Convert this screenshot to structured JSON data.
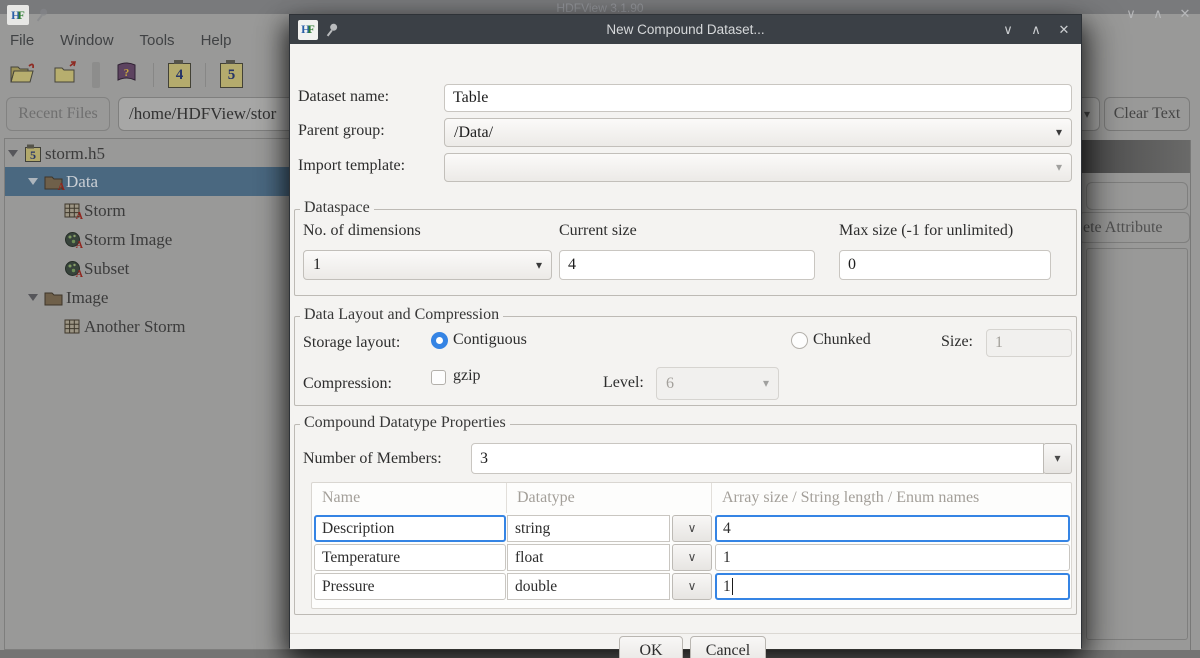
{
  "colors": {
    "accent": "#3584e4",
    "dialog_title_bar": "#3b4046",
    "tree_selection": "#4a6880",
    "dim_background": "#999998"
  },
  "icons": {
    "dropdown": "▾",
    "chevron_down": "∨",
    "minimize": "∨",
    "maximize": "∧",
    "close": "✕",
    "help_glyph": "?",
    "hdf4_glyph": "4",
    "hdf5_glyph": "5",
    "logo_h": "H",
    "logo_f": "F"
  },
  "main_window": {
    "title": "HDFView 3.1.90",
    "menu": {
      "file": "File",
      "window": "Window",
      "tools": "Tools",
      "help": "Help"
    },
    "recent_files_label": "Recent Files",
    "path_value": "/home/HDFView/stor",
    "clear_text_label": "Clear Text",
    "delete_attribute_partial_label": "ete Attribute",
    "tree": {
      "items": [
        {
          "label": "storm.h5"
        },
        {
          "label": "Data"
        },
        {
          "label": "Storm"
        },
        {
          "label": "Storm Image"
        },
        {
          "label": "Subset"
        },
        {
          "label": "Image"
        },
        {
          "label": "Another Storm"
        }
      ]
    },
    "attr_badge": "A"
  },
  "dialog": {
    "title": "New Compound Dataset...",
    "fields": {
      "dataset_name_label": "Dataset name:",
      "dataset_name_value": "Table",
      "parent_group_label": "Parent group:",
      "parent_group_value": "/Data/",
      "import_template_label": "Import template:",
      "import_template_value": ""
    },
    "dataspace": {
      "legend": "Dataspace",
      "no_of_dimensions_label": "No. of dimensions",
      "no_of_dimensions_value": "1",
      "current_size_label": "Current size",
      "current_size_value": "4",
      "max_size_label": "Max size (-1 for unlimited)",
      "max_size_value": "0"
    },
    "layout": {
      "legend": "Data Layout and Compression",
      "storage_layout_label": "Storage layout:",
      "contiguous_label": "Contiguous",
      "chunked_label": "Chunked",
      "size_label": "Size:",
      "size_value": "1",
      "compression_label": "Compression:",
      "gzip_label": "gzip",
      "level_label": "Level:",
      "level_value": "6"
    },
    "compound": {
      "legend": "Compound Datatype Properties",
      "number_of_members_label": "Number of Members:",
      "number_of_members_value": "3",
      "table": {
        "headers": [
          "Name",
          "Datatype",
          "Array size / String length / Enum names"
        ],
        "rows": [
          {
            "name": "Description",
            "datatype": "string",
            "array_size": "4"
          },
          {
            "name": "Temperature",
            "datatype": "float",
            "array_size": "1"
          },
          {
            "name": "Pressure",
            "datatype": "double",
            "array_size": "1"
          }
        ]
      }
    },
    "buttons": {
      "ok": "OK",
      "cancel": "Cancel"
    }
  }
}
